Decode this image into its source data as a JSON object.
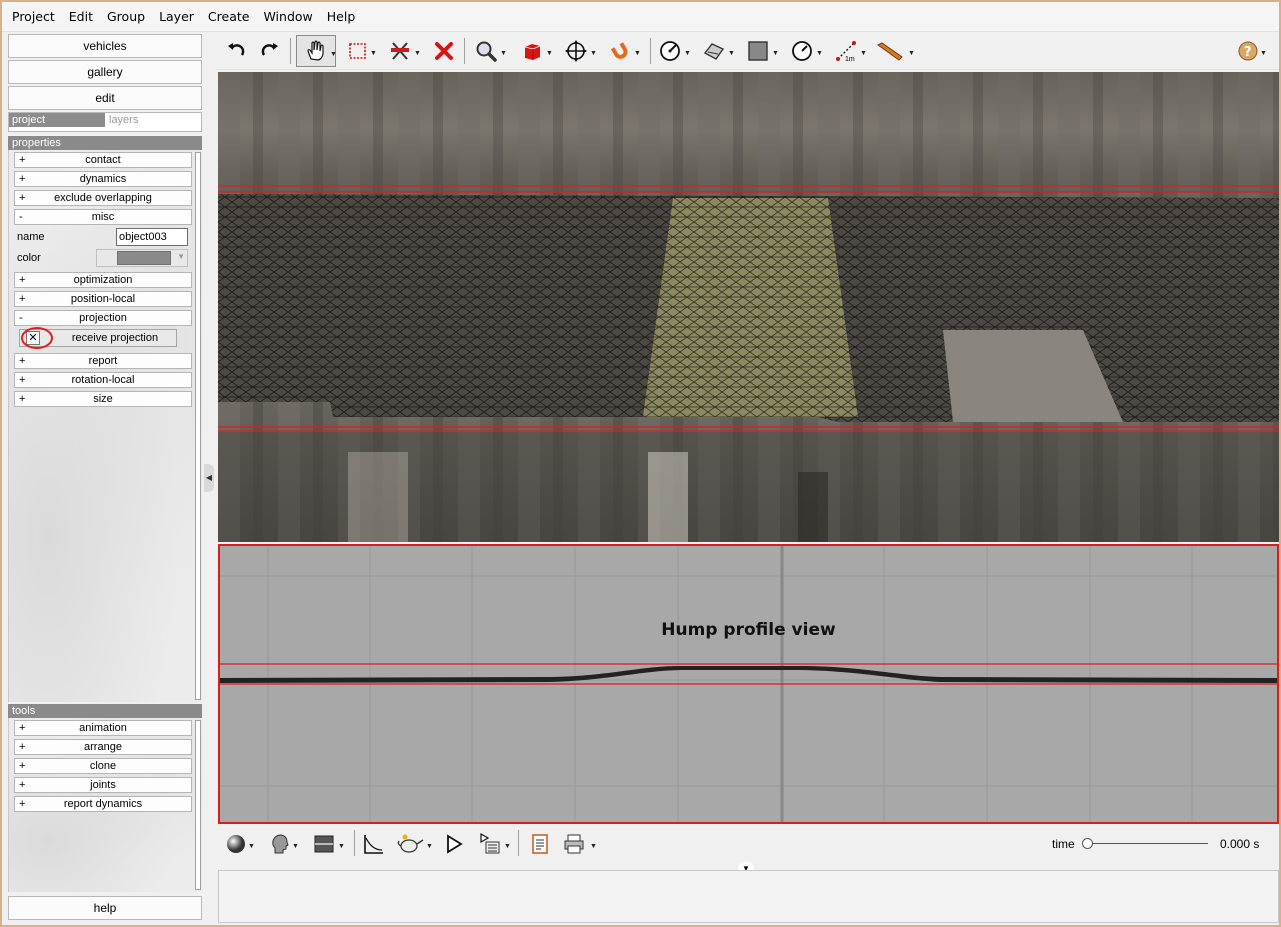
{
  "menu": [
    "Project",
    "Edit",
    "Group",
    "Layer",
    "Create",
    "Window",
    "Help"
  ],
  "left": {
    "buttons": {
      "vehicles": "vehicles",
      "gallery": "gallery",
      "edit": "edit"
    },
    "tabs": {
      "project": "project",
      "layers": "layers"
    },
    "properties_header": "properties",
    "properties": [
      {
        "sign": "+",
        "label": "contact"
      },
      {
        "sign": "+",
        "label": "dynamics"
      },
      {
        "sign": "+",
        "label": "exclude overlapping"
      },
      {
        "sign": "-",
        "label": "misc"
      },
      {
        "sign": "+",
        "label": "optimization"
      },
      {
        "sign": "+",
        "label": "position-local"
      },
      {
        "sign": "-",
        "label": "projection"
      },
      {
        "sign": "+",
        "label": "report"
      },
      {
        "sign": "+",
        "label": "rotation-local"
      },
      {
        "sign": "+",
        "label": "size"
      }
    ],
    "misc": {
      "name_label": "name",
      "name_value": "object003",
      "color_label": "color",
      "color_value": "#8a8a8a"
    },
    "projection": {
      "receive_label": "receive projection",
      "receive_checked": true,
      "check_mark": "✕"
    },
    "tools_header": "tools",
    "tools": [
      {
        "sign": "+",
        "label": "animation"
      },
      {
        "sign": "+",
        "label": "arrange"
      },
      {
        "sign": "+",
        "label": "clone"
      },
      {
        "sign": "+",
        "label": "joints"
      },
      {
        "sign": "+",
        "label": "report dynamics"
      }
    ],
    "help": "help"
  },
  "toolbar": {
    "icons": [
      "undo-icon",
      "redo-icon",
      "hand-pan-icon",
      "rectangle-select-icon",
      "cut-icon",
      "delete-icon",
      "zoom-icon",
      "cube-icon",
      "move-icon",
      "magnet-icon",
      "rotate-icon",
      "terrain-icon",
      "square-icon",
      "gauge-icon",
      "measure-icon",
      "pencil-icon",
      "help-icon"
    ]
  },
  "profile": {
    "title": "Hump profile view"
  },
  "bottom": {
    "time_label": "time",
    "time_value": "0.000 s",
    "time_fraction": 0.0
  },
  "colors": {
    "accent_red": "#d71f1f",
    "mesh_yellow": "#c8c878"
  }
}
